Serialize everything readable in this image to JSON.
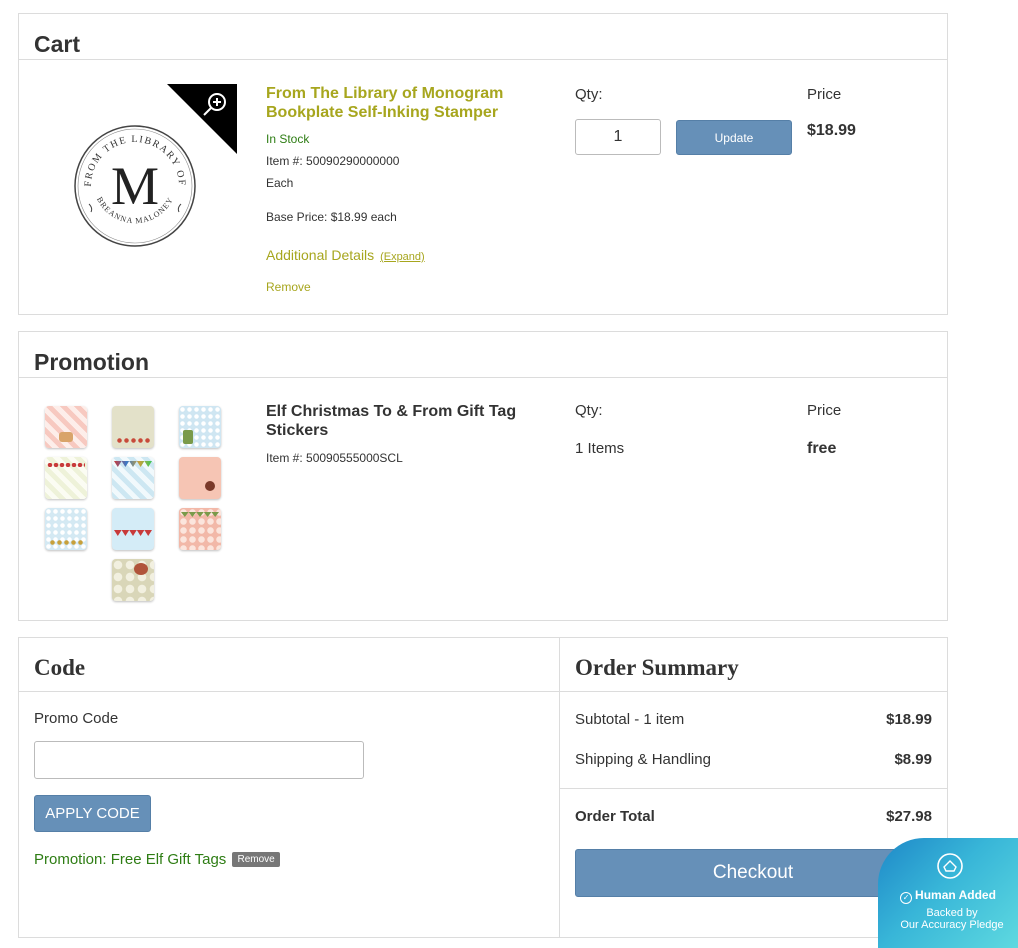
{
  "cart": {
    "heading": "Cart",
    "item": {
      "title": "From The Library of Monogram Bookplate Self-Inking Stamper",
      "stock": "In Stock",
      "item_number": "Item #: 50090290000000",
      "unit": "Each",
      "base_price": "Base Price: $18.99 each",
      "additional_details": "Additional Details",
      "expand": "(Expand)",
      "remove": "Remove",
      "qty_label": "Qty:",
      "qty_value": "1",
      "update_label": "Update",
      "price_label": "Price",
      "price": "$18.99",
      "stamp_text": {
        "top": "FROM THE LIBRARY OF",
        "initial": "M",
        "bottom": "BREANNA MALONEY"
      }
    }
  },
  "promotion": {
    "heading": "Promotion",
    "title": "Elf Christmas To & From Gift Tag Stickers",
    "item_number": "Item #: 50090555000SCL",
    "qty_label": "Qty:",
    "qty_value": "1 Items",
    "price_label": "Price",
    "price": "free"
  },
  "code": {
    "heading": "Code",
    "promo_label": "Promo Code",
    "promo_value": "",
    "apply_label": "APPLY CODE",
    "applied_text": "Promotion: Free Elf Gift Tags",
    "applied_remove": "Remove"
  },
  "summary": {
    "heading": "Order Summary",
    "subtotal_label": "Subtotal - 1 item",
    "subtotal": "$18.99",
    "shipping_label": "Shipping & Handling",
    "shipping": "$8.99",
    "total_label": "Order Total",
    "total": "$27.98",
    "checkout_label": "Checkout"
  },
  "badge": {
    "main": "Human Added",
    "line1": "Backed by",
    "line2": "Our Accuracy Pledge"
  },
  "colors": {
    "accent_olive": "#a7a61e",
    "button_blue": "#6690b8",
    "stock_green": "#2e7d14"
  },
  "icons": {
    "zoom": "zoom-in-icon",
    "badge": "shield-logo-icon",
    "check": "check-circle-icon"
  }
}
